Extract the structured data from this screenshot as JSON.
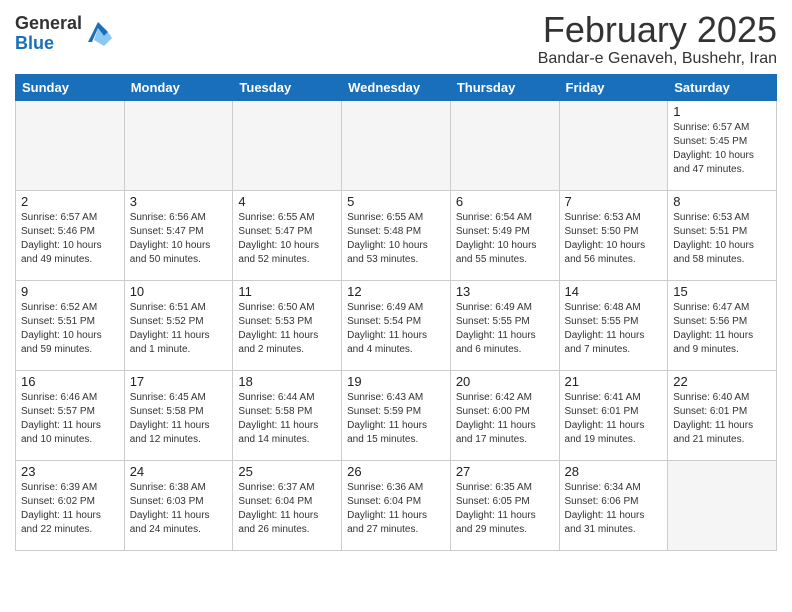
{
  "logo": {
    "general": "General",
    "blue": "Blue"
  },
  "title": "February 2025",
  "location": "Bandar-e Genaveh, Bushehr, Iran",
  "weekdays": [
    "Sunday",
    "Monday",
    "Tuesday",
    "Wednesday",
    "Thursday",
    "Friday",
    "Saturday"
  ],
  "weeks": [
    [
      {
        "day": "",
        "info": ""
      },
      {
        "day": "",
        "info": ""
      },
      {
        "day": "",
        "info": ""
      },
      {
        "day": "",
        "info": ""
      },
      {
        "day": "",
        "info": ""
      },
      {
        "day": "",
        "info": ""
      },
      {
        "day": "1",
        "info": "Sunrise: 6:57 AM\nSunset: 5:45 PM\nDaylight: 10 hours and 47 minutes."
      }
    ],
    [
      {
        "day": "2",
        "info": "Sunrise: 6:57 AM\nSunset: 5:46 PM\nDaylight: 10 hours and 49 minutes."
      },
      {
        "day": "3",
        "info": "Sunrise: 6:56 AM\nSunset: 5:47 PM\nDaylight: 10 hours and 50 minutes."
      },
      {
        "day": "4",
        "info": "Sunrise: 6:55 AM\nSunset: 5:47 PM\nDaylight: 10 hours and 52 minutes."
      },
      {
        "day": "5",
        "info": "Sunrise: 6:55 AM\nSunset: 5:48 PM\nDaylight: 10 hours and 53 minutes."
      },
      {
        "day": "6",
        "info": "Sunrise: 6:54 AM\nSunset: 5:49 PM\nDaylight: 10 hours and 55 minutes."
      },
      {
        "day": "7",
        "info": "Sunrise: 6:53 AM\nSunset: 5:50 PM\nDaylight: 10 hours and 56 minutes."
      },
      {
        "day": "8",
        "info": "Sunrise: 6:53 AM\nSunset: 5:51 PM\nDaylight: 10 hours and 58 minutes."
      }
    ],
    [
      {
        "day": "9",
        "info": "Sunrise: 6:52 AM\nSunset: 5:51 PM\nDaylight: 10 hours and 59 minutes."
      },
      {
        "day": "10",
        "info": "Sunrise: 6:51 AM\nSunset: 5:52 PM\nDaylight: 11 hours and 1 minute."
      },
      {
        "day": "11",
        "info": "Sunrise: 6:50 AM\nSunset: 5:53 PM\nDaylight: 11 hours and 2 minutes."
      },
      {
        "day": "12",
        "info": "Sunrise: 6:49 AM\nSunset: 5:54 PM\nDaylight: 11 hours and 4 minutes."
      },
      {
        "day": "13",
        "info": "Sunrise: 6:49 AM\nSunset: 5:55 PM\nDaylight: 11 hours and 6 minutes."
      },
      {
        "day": "14",
        "info": "Sunrise: 6:48 AM\nSunset: 5:55 PM\nDaylight: 11 hours and 7 minutes."
      },
      {
        "day": "15",
        "info": "Sunrise: 6:47 AM\nSunset: 5:56 PM\nDaylight: 11 hours and 9 minutes."
      }
    ],
    [
      {
        "day": "16",
        "info": "Sunrise: 6:46 AM\nSunset: 5:57 PM\nDaylight: 11 hours and 10 minutes."
      },
      {
        "day": "17",
        "info": "Sunrise: 6:45 AM\nSunset: 5:58 PM\nDaylight: 11 hours and 12 minutes."
      },
      {
        "day": "18",
        "info": "Sunrise: 6:44 AM\nSunset: 5:58 PM\nDaylight: 11 hours and 14 minutes."
      },
      {
        "day": "19",
        "info": "Sunrise: 6:43 AM\nSunset: 5:59 PM\nDaylight: 11 hours and 15 minutes."
      },
      {
        "day": "20",
        "info": "Sunrise: 6:42 AM\nSunset: 6:00 PM\nDaylight: 11 hours and 17 minutes."
      },
      {
        "day": "21",
        "info": "Sunrise: 6:41 AM\nSunset: 6:01 PM\nDaylight: 11 hours and 19 minutes."
      },
      {
        "day": "22",
        "info": "Sunrise: 6:40 AM\nSunset: 6:01 PM\nDaylight: 11 hours and 21 minutes."
      }
    ],
    [
      {
        "day": "23",
        "info": "Sunrise: 6:39 AM\nSunset: 6:02 PM\nDaylight: 11 hours and 22 minutes."
      },
      {
        "day": "24",
        "info": "Sunrise: 6:38 AM\nSunset: 6:03 PM\nDaylight: 11 hours and 24 minutes."
      },
      {
        "day": "25",
        "info": "Sunrise: 6:37 AM\nSunset: 6:04 PM\nDaylight: 11 hours and 26 minutes."
      },
      {
        "day": "26",
        "info": "Sunrise: 6:36 AM\nSunset: 6:04 PM\nDaylight: 11 hours and 27 minutes."
      },
      {
        "day": "27",
        "info": "Sunrise: 6:35 AM\nSunset: 6:05 PM\nDaylight: 11 hours and 29 minutes."
      },
      {
        "day": "28",
        "info": "Sunrise: 6:34 AM\nSunset: 6:06 PM\nDaylight: 11 hours and 31 minutes."
      },
      {
        "day": "",
        "info": ""
      }
    ]
  ]
}
